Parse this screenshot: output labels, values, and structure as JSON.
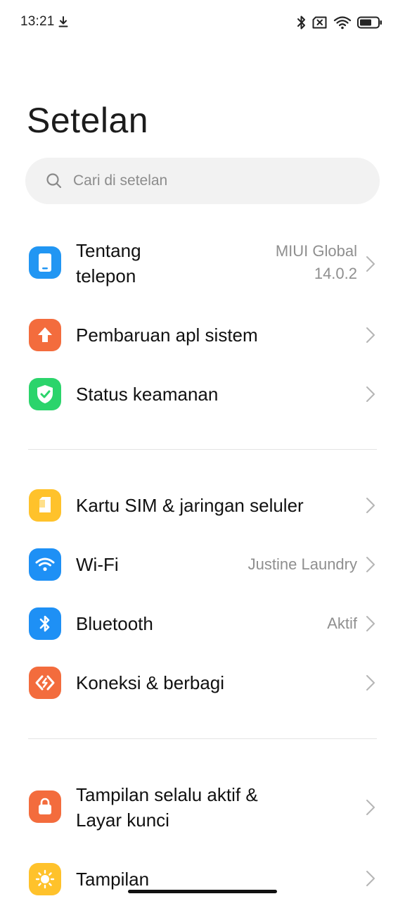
{
  "status_bar": {
    "time": "13:21"
  },
  "title": "Setelan",
  "search": {
    "placeholder": "Cari di setelan"
  },
  "colors": {
    "phone": "#2196F3",
    "update": "#F36C3D",
    "security": "#2BD46B",
    "sim": "#FFC22B",
    "wifi": "#1E90F5",
    "bluetooth": "#1E90F5",
    "connection": "#F36C3D",
    "lock": "#F36C3D",
    "display": "#FFC22B"
  },
  "groups": [
    {
      "items": [
        {
          "label_line1": "Tentang",
          "label_line2": "telepon",
          "value_line1": "MIUI Global",
          "value_line2": "14.0.2",
          "icon": "phone-icon"
        },
        {
          "label": "Pembaruan apl sistem",
          "icon": "update-arrow-icon"
        },
        {
          "label": "Status keamanan",
          "icon": "shield-check-icon"
        }
      ]
    },
    {
      "items": [
        {
          "label": "Kartu SIM & jaringan seluler",
          "icon": "sim-card-icon"
        },
        {
          "label": "Wi-Fi",
          "value": "Justine Laundry",
          "icon": "wifi-icon"
        },
        {
          "label": "Bluetooth",
          "value": "Aktif",
          "icon": "bluetooth-icon"
        },
        {
          "label": "Koneksi & berbagi",
          "icon": "connection-sharing-icon"
        }
      ]
    },
    {
      "items": [
        {
          "label_line1": "Tampilan selalu aktif &",
          "label_line2": "Layar kunci",
          "icon": "lock-icon"
        },
        {
          "label": "Tampilan",
          "icon": "sun-icon"
        }
      ]
    }
  ]
}
